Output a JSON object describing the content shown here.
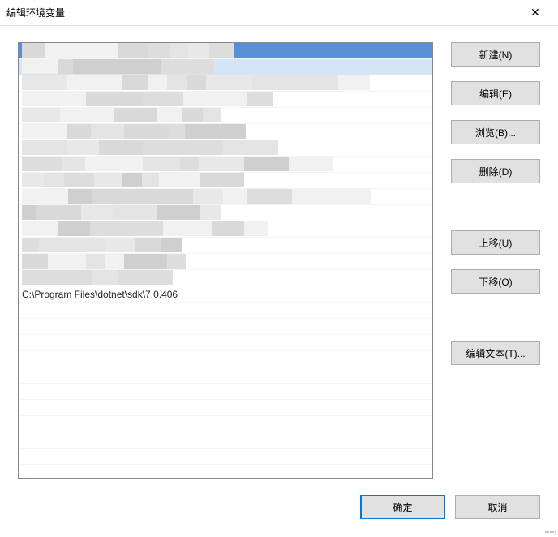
{
  "window": {
    "title": "编辑环境变量"
  },
  "buttons": {
    "new": "新建(N)",
    "edit": "编辑(E)",
    "browse": "浏览(B)...",
    "delete": "删除(D)",
    "move_up": "上移(U)",
    "move_down": "下移(O)",
    "edit_text": "编辑文本(T)...",
    "ok": "确定",
    "cancel": "取消"
  },
  "list": {
    "selected_index": 0,
    "visible_value": "C:\\Program Files\\dotnet\\sdk\\7.0.406",
    "obscured_count": 15,
    "visible_at_index": 15
  },
  "colors": {
    "selection": "#5a8fd8",
    "selection_adjacent": "#d6e5f5",
    "button_bg": "#e1e1e1",
    "button_border": "#adadad",
    "primary_border": "#0078d7",
    "listbox_border": "#828790"
  }
}
